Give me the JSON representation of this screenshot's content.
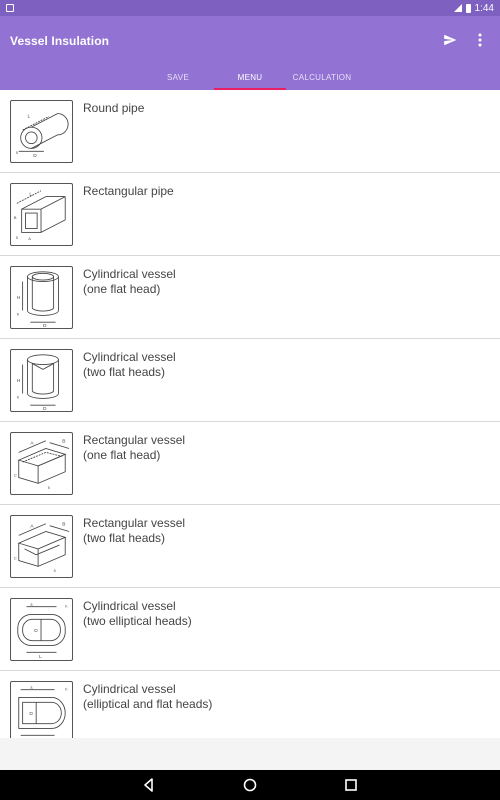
{
  "status_bar": {
    "time": "1:44",
    "notification_icon": "a",
    "signal_icon": "signal-icon",
    "battery_icon": "battery-icon"
  },
  "app_bar": {
    "title": "Vessel Insulation",
    "send_icon": "send-icon",
    "overflow_icon": "more-vert-icon"
  },
  "colors": {
    "status_bar": "#7e60c0",
    "app_bar": "#9272d2",
    "tab_indicator": "#e91e63"
  },
  "tabs": [
    {
      "label": "SAVE"
    },
    {
      "label": "MENU",
      "active": true
    },
    {
      "label": "CALCULATION"
    }
  ],
  "items": [
    {
      "line1": "Round pipe",
      "line2": "",
      "icon": "round-pipe-diagram-icon"
    },
    {
      "line1": "Rectangular pipe",
      "line2": "",
      "icon": "rectangular-pipe-diagram-icon"
    },
    {
      "line1": "Cylindrical vessel",
      "line2": "(one flat head)",
      "icon": "cylindrical-vessel-one-flat-head-icon"
    },
    {
      "line1": "Cylindrical vessel",
      "line2": "(two flat heads)",
      "icon": "cylindrical-vessel-two-flat-heads-icon"
    },
    {
      "line1": "Rectangular vessel",
      "line2": "(one flat head)",
      "icon": "rectangular-vessel-one-flat-head-icon"
    },
    {
      "line1": "Rectangular vessel",
      "line2": "(two flat heads)",
      "icon": "rectangular-vessel-two-flat-heads-icon"
    },
    {
      "line1": "Cylindrical vessel",
      "line2": "(two elliptical heads)",
      "icon": "cylindrical-vessel-two-elliptical-heads-icon"
    },
    {
      "line1": "Cylindrical vessel",
      "line2": "(elliptical and flat heads)",
      "icon": "cylindrical-vessel-elliptical-flat-heads-icon"
    }
  ],
  "nav_bar": {
    "back_icon": "back-icon",
    "home_icon": "home-icon",
    "recents_icon": "recents-icon"
  }
}
